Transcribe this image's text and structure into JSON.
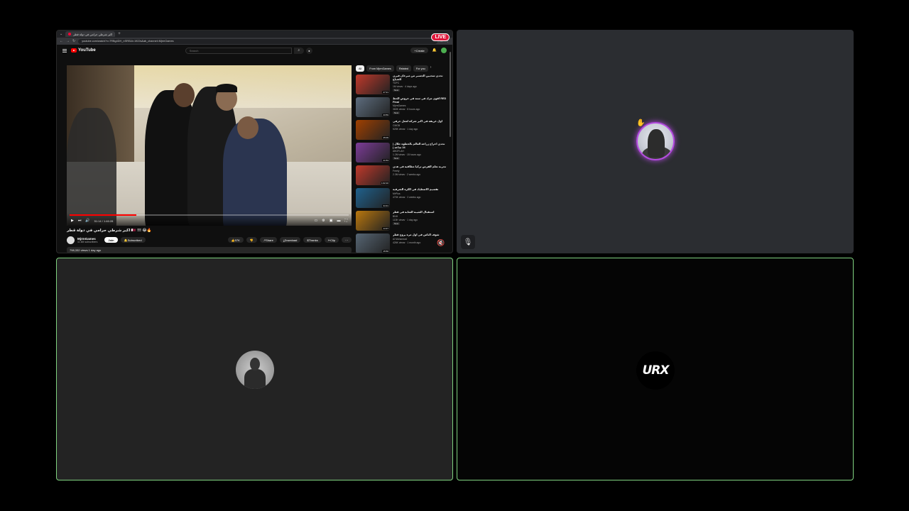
{
  "browser": {
    "tab_title": "اكبر شرطي حرامي في دولة قطر",
    "url": "youtube.com/watch?v=7RBg4DH_nSRE&t=1922s&ab_channel=MjrmGames",
    "live_label": "LIVE"
  },
  "youtube": {
    "logo_text": "YouTube",
    "search_placeholder": "Search",
    "create_label": "Create"
  },
  "video": {
    "current_time": "51:14 / 1:46:28",
    "progress": 0.24,
    "title": "اكبر شرطي حرامي في دولة قطر 🇶🇦 !!! 😂🔥",
    "channel": "MjrmGames",
    "subscribers": "11.6M subscribers",
    "join_label": "Join",
    "subscribed_label": "Subscribed",
    "likes": "57K",
    "share_label": "Share",
    "download_label": "Download",
    "thanks_label": "Thanks",
    "clip_label": "Clip",
    "views_date": "798,332 views  1 day ago"
  },
  "sidebar": {
    "chips": [
      "All",
      "From MjrmGames",
      "Related",
      "For you"
    ],
    "recommendations": [
      {
        "title": "تحدي سحبين الجسبر من ميرغان فيري للضياع",
        "channel": "TDPC",
        "stats": "1M views · 4 days ago",
        "badge": "New",
        "duration": "27:21",
        "color": "#c0392b"
      },
      {
        "title": "اقوى مزاد في سنة في عروض الحظ RED Final",
        "channel": "MjrmGames",
        "stats": "360K views · 8 hours ago",
        "badge": "New",
        "duration": "43:59",
        "color": "#5d6d7e"
      },
      {
        "title": "أول غريفة في اكبر شركة لعمل حرفي",
        "channel": "CMGB",
        "stats": "525K views · 1 day ago",
        "badge": "",
        "duration": "25:09",
        "color": "#a04000"
      },
      {
        "title": "تحدي اخراج زراعة العالم بالخطوة خلال ( 24 ساعة )",
        "channel": "ABOFLAH",
        "stats": "1.2M views · 15 hours ago",
        "badge": "New",
        "duration": "41:53",
        "color": "#7d3c98"
      },
      {
        "title": "تجربة تعلم الفرس تركيا مطاقية في هدي",
        "channel": "Freely",
        "stats": "2.3M views · 2 weeks ago",
        "badge": "",
        "duration": "1:02:10",
        "color": "#c0392b"
      },
      {
        "title": "تقسيم الاصطياد في الكرة الشرقية",
        "channel": "MrPlus",
        "stats": "470K views · 2 weeks ago",
        "badge": "",
        "duration": "34:31",
        "color": "#1f618d"
      },
      {
        "title": "استقبال الشيبة الشابة في قطر",
        "channel": "BNH",
        "stats": "113K views · 1 day ago",
        "badge": "New",
        "duration": "14:37",
        "color": "#b9770e"
      },
      {
        "title": "شوف الناس في اول مرة يروح قطر",
        "channel": "Al Mohannad",
        "stats": "426K views · 1 month ago",
        "badge": "",
        "duration": "15:56",
        "color": "#566573"
      }
    ]
  },
  "participants": {
    "tile_a": {
      "ring_color": "#b44ae0"
    },
    "tile_c": {
      "logo_text": "URX"
    }
  }
}
